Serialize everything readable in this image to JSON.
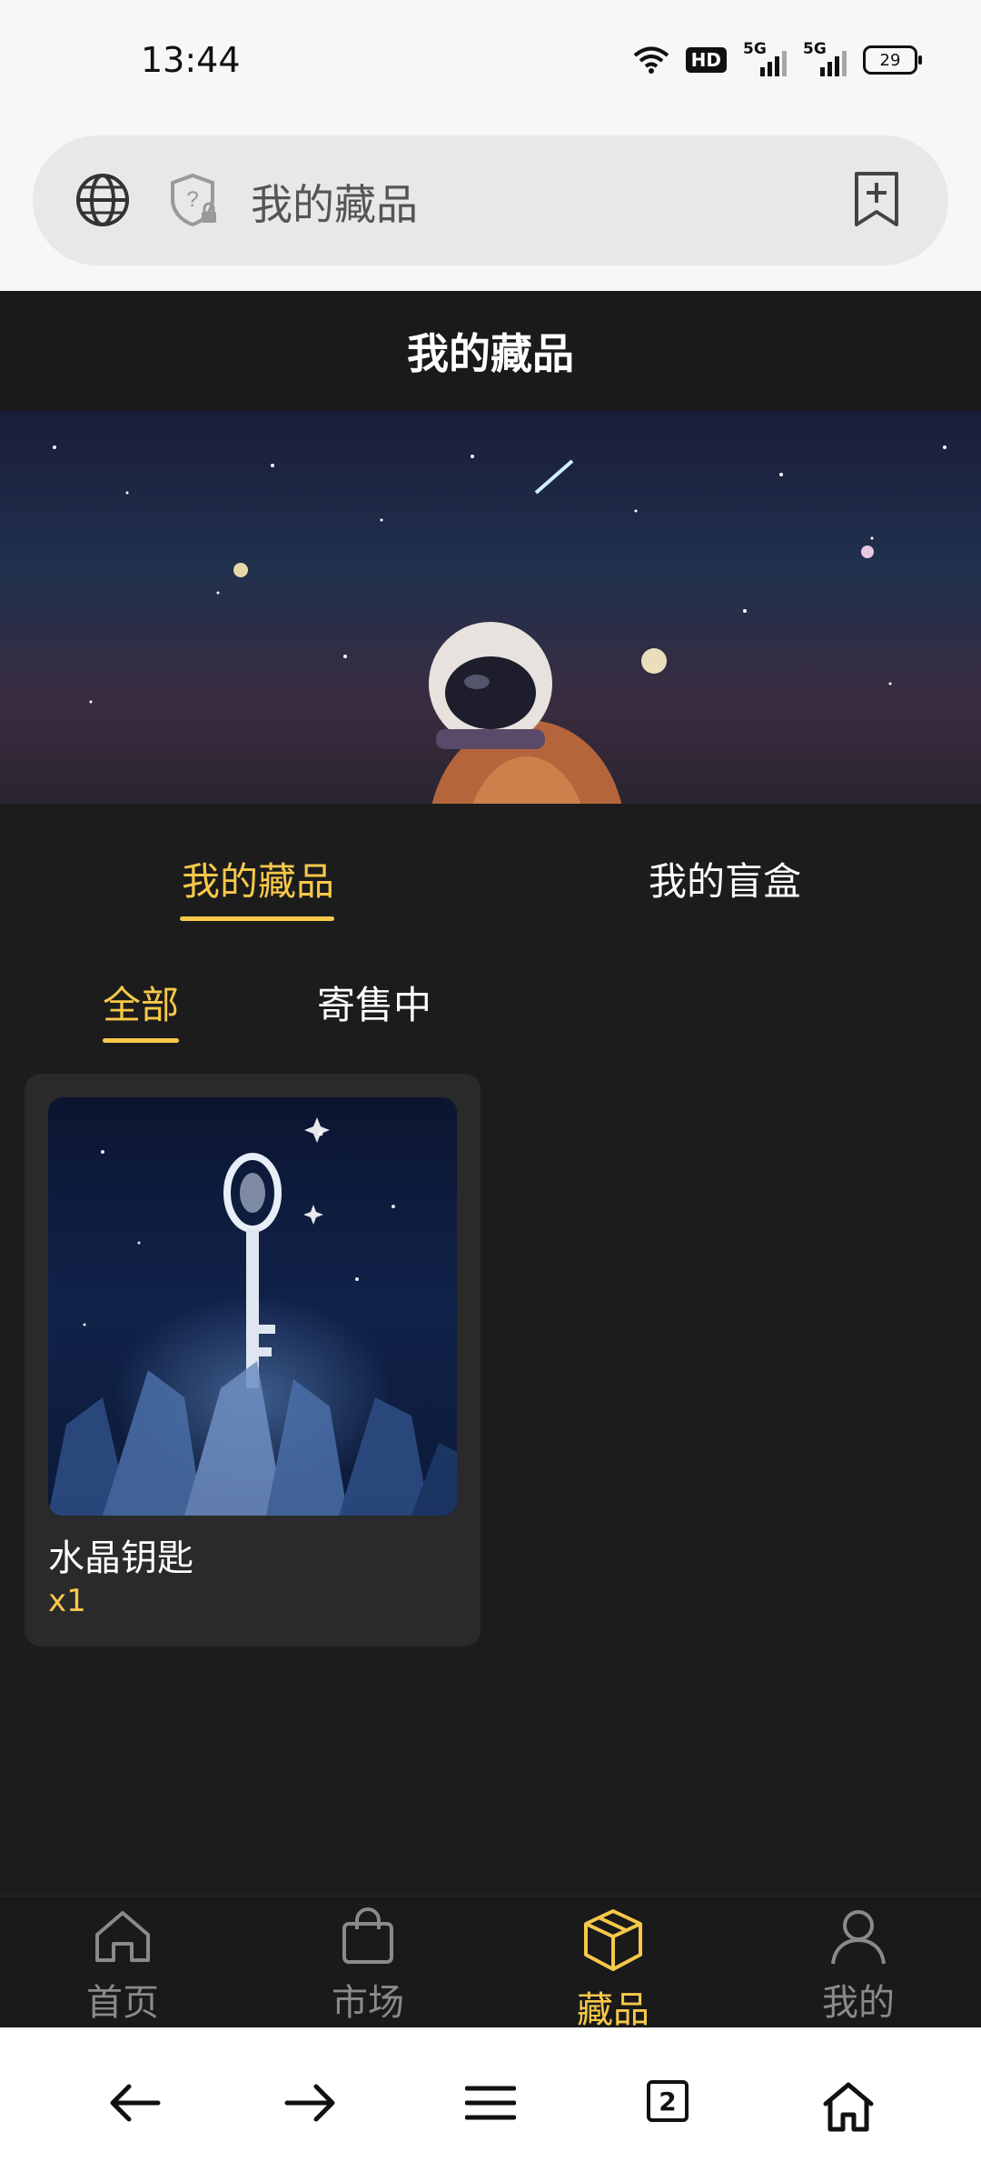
{
  "status_bar": {
    "time": "13:44",
    "hd_label": "HD",
    "sig1_label": "5G",
    "sig2_label": "5G",
    "battery": "29"
  },
  "browser": {
    "url_text": "我的藏品",
    "tab_count": "2"
  },
  "page": {
    "title": "我的藏品"
  },
  "tabs": [
    {
      "label": "我的藏品",
      "active": true
    },
    {
      "label": "我的盲盒",
      "active": false
    }
  ],
  "subtabs": [
    {
      "label": "全部",
      "active": true
    },
    {
      "label": "寄售中",
      "active": false
    }
  ],
  "collection": [
    {
      "name": "水晶钥匙",
      "quantity": "x1"
    }
  ],
  "bottom_nav": [
    {
      "label": "首页",
      "icon": "home-icon"
    },
    {
      "label": "市场",
      "icon": "bag-icon"
    },
    {
      "label": "藏品",
      "icon": "cube-icon",
      "active": true
    },
    {
      "label": "我的",
      "icon": "user-icon"
    }
  ],
  "colors": {
    "accent": "#f7c84a",
    "background": "#1c1c1c",
    "card": "#2a2a2a"
  }
}
